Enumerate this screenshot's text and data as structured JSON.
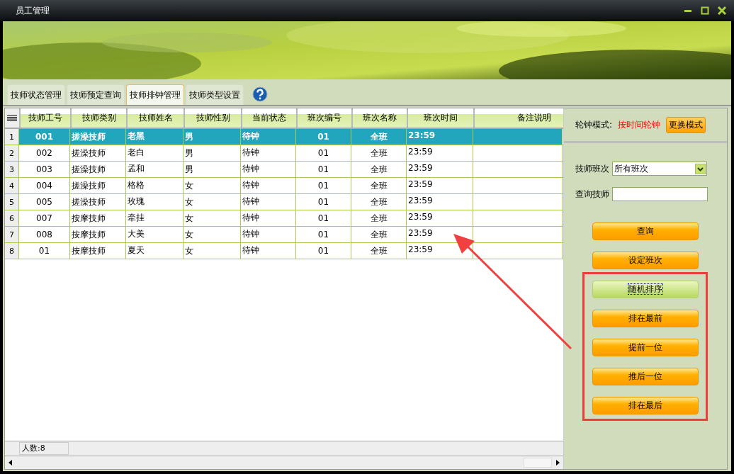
{
  "window": {
    "title": "员工管理"
  },
  "tabs": [
    {
      "label": "技师状态管理",
      "selected": false
    },
    {
      "label": "技师预定查询",
      "selected": false
    },
    {
      "label": "技师排钟管理",
      "selected": true
    },
    {
      "label": "技师类型设置",
      "selected": false
    }
  ],
  "table": {
    "columns": [
      "技师工号",
      "技师类别",
      "技师姓名",
      "技师性别",
      "当前状态",
      "班次编号",
      "班次名称",
      "班次时间",
      "备注说明"
    ],
    "rows": [
      {
        "index": "1",
        "selected": true,
        "cells": [
          "001",
          "搓澡技师",
          "老黑",
          "男",
          "待钟",
          "01",
          "全班",
          "23:59"
        ]
      },
      {
        "index": "2",
        "selected": false,
        "cells": [
          "002",
          "搓澡技师",
          "老白",
          "男",
          "待钟",
          "01",
          "全班",
          "23:59"
        ]
      },
      {
        "index": "3",
        "selected": false,
        "cells": [
          "003",
          "搓澡技师",
          "孟和",
          "男",
          "待钟",
          "01",
          "全班",
          "23:59"
        ]
      },
      {
        "index": "4",
        "selected": false,
        "cells": [
          "004",
          "搓澡技师",
          "格格",
          "女",
          "待钟",
          "01",
          "全班",
          "23:59"
        ]
      },
      {
        "index": "5",
        "selected": false,
        "cells": [
          "005",
          "搓澡技师",
          "玫瑰",
          "女",
          "待钟",
          "01",
          "全班",
          "23:59"
        ]
      },
      {
        "index": "6",
        "selected": false,
        "cells": [
          "007",
          "按摩技师",
          "牵挂",
          "女",
          "待钟",
          "01",
          "全班",
          "23:59"
        ]
      },
      {
        "index": "7",
        "selected": false,
        "cells": [
          "008",
          "按摩技师",
          "大美",
          "女",
          "待钟",
          "01",
          "全班",
          "23:59"
        ]
      },
      {
        "index": "8",
        "selected": false,
        "cells": [
          "01",
          "按摩技师",
          "夏天",
          "女",
          "待钟",
          "01",
          "全班",
          "23:59"
        ]
      }
    ],
    "summary": "人数:8"
  },
  "panel": {
    "mode_label": "轮钟模式:",
    "mode_value": "按时间轮钟",
    "mode_button": "更换模式",
    "shift_label": "技师班次",
    "shift_value": "所有班次",
    "search_label": "查询技师",
    "buttons": [
      {
        "label": "查询",
        "focused": false
      },
      {
        "label": "设定班次",
        "focused": false
      },
      {
        "label": "随机排序",
        "focused": true
      },
      {
        "label": "排在最前",
        "focused": false
      },
      {
        "label": "提前一位",
        "focused": false
      },
      {
        "label": "推后一位",
        "focused": false
      },
      {
        "label": "排在最后",
        "focused": false
      }
    ]
  }
}
